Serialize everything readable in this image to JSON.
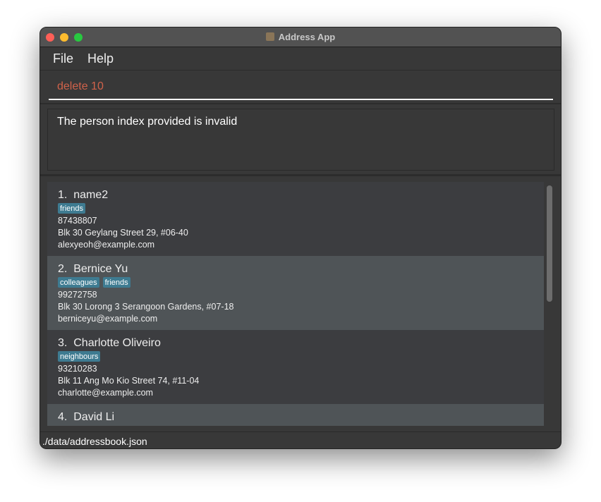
{
  "window": {
    "title": "Address App",
    "controls": {
      "close": "#ff5f57",
      "minimize": "#febc2e",
      "zoom": "#28c840"
    }
  },
  "menu": {
    "items": [
      "File",
      "Help"
    ]
  },
  "command": {
    "value": "delete 10",
    "text_color": "#d0624a"
  },
  "result": {
    "message": "The person index provided is invalid"
  },
  "persons": [
    {
      "index": "1.",
      "name": "name2",
      "tags": [
        "friends"
      ],
      "phone": "87438807",
      "address": "Blk 30 Geylang Street 29, #06-40",
      "email": "alexyeoh@example.com"
    },
    {
      "index": "2.",
      "name": "Bernice Yu",
      "tags": [
        "colleagues",
        "friends"
      ],
      "phone": "99272758",
      "address": "Blk 30 Lorong 3 Serangoon Gardens, #07-18",
      "email": "berniceyu@example.com"
    },
    {
      "index": "3.",
      "name": "Charlotte Oliveiro",
      "tags": [
        "neighbours"
      ],
      "phone": "93210283",
      "address": "Blk 11 Ang Mo Kio Street 74, #11-04",
      "email": "charlotte@example.com"
    },
    {
      "index": "4.",
      "name": "David Li",
      "tags": [],
      "phone": "",
      "address": "",
      "email": ""
    }
  ],
  "status": {
    "path": "./data/addressbook.json"
  }
}
